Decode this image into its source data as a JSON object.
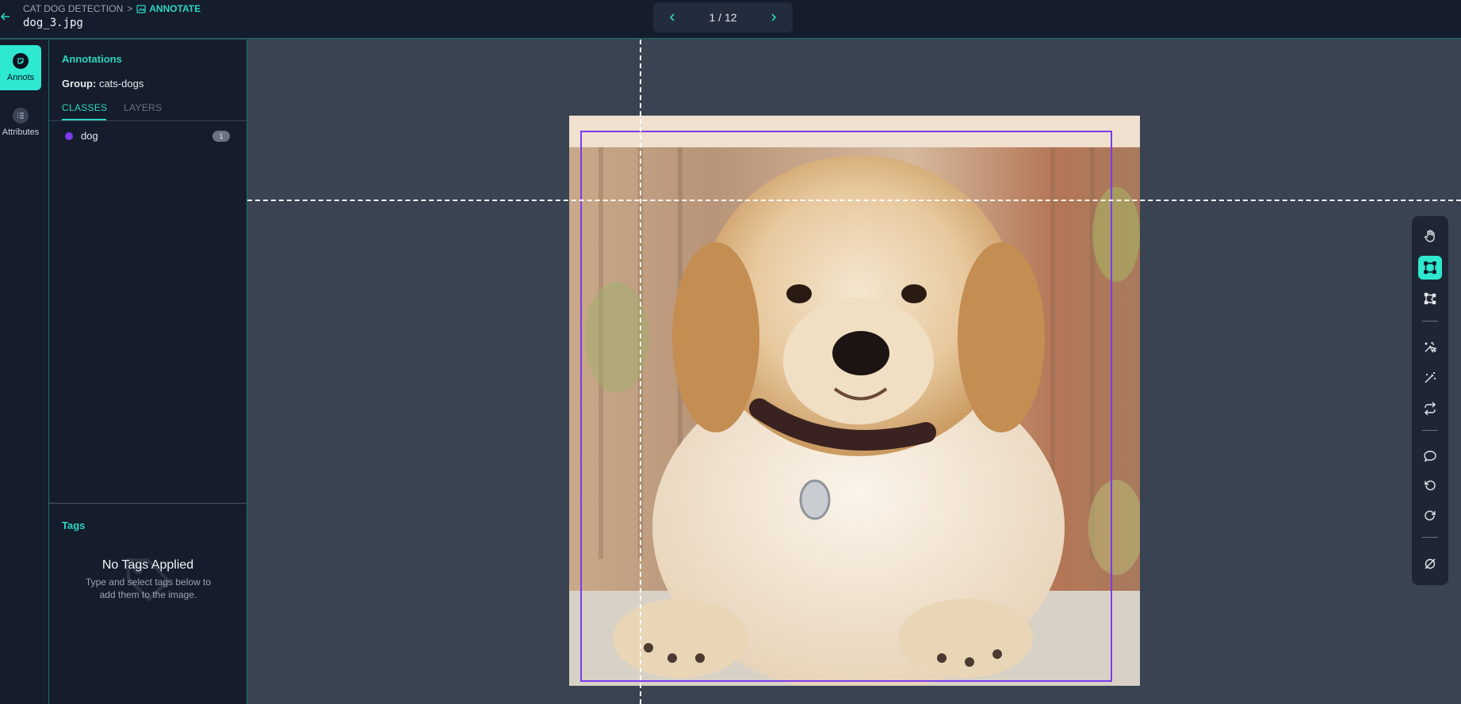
{
  "header": {
    "breadcrumb": {
      "project": "CAT DOG DETECTION",
      "separator": ">",
      "current": "ANNOTATE"
    },
    "filename": "dog_3.jpg",
    "pager": {
      "text": "1 / 12"
    }
  },
  "rail": {
    "items": [
      {
        "label": "Annots",
        "icon": "annotation-icon",
        "active": true
      },
      {
        "label": "Attributes",
        "icon": "list-icon",
        "active": false
      }
    ]
  },
  "panel": {
    "title": "Annotations",
    "group_label": "Group:",
    "group_value": "cats-dogs",
    "tabs": [
      {
        "label": "CLASSES",
        "active": true
      },
      {
        "label": "LAYERS",
        "active": false
      }
    ],
    "classes": [
      {
        "name": "dog",
        "count": "1",
        "color": "#7c3aed"
      }
    ],
    "tags": {
      "title": "Tags",
      "empty_title": "No Tags Applied",
      "empty_text": "Type and select tags below to add them to the image."
    }
  },
  "canvas": {
    "image_alt": "golden retriever puppy",
    "box_color": "#7c3aed"
  },
  "toolbar": {
    "tools": [
      {
        "name": "pan-tool",
        "icon": "hand-icon",
        "active": false
      },
      {
        "name": "bbox-tool",
        "icon": "bounding-box-icon",
        "active": true
      },
      {
        "name": "polygon-tool",
        "icon": "polygon-icon",
        "active": false
      },
      {
        "name": "auto-select-tool",
        "icon": "magic-select-icon",
        "active": false
      },
      {
        "name": "magic-wand-tool",
        "icon": "magic-wand-icon",
        "active": false
      },
      {
        "name": "convert-tool",
        "icon": "repeat-icon",
        "active": false
      },
      {
        "name": "comment-tool",
        "icon": "comment-icon",
        "active": false
      },
      {
        "name": "undo-tool",
        "icon": "undo-icon",
        "active": false
      },
      {
        "name": "redo-tool",
        "icon": "redo-icon",
        "active": false
      },
      {
        "name": "null-tool",
        "icon": "null-icon",
        "active": false
      }
    ]
  },
  "colors": {
    "accent": "#2ee8cf",
    "panel_bg": "#151d2c",
    "canvas_bg": "#3a4352"
  }
}
